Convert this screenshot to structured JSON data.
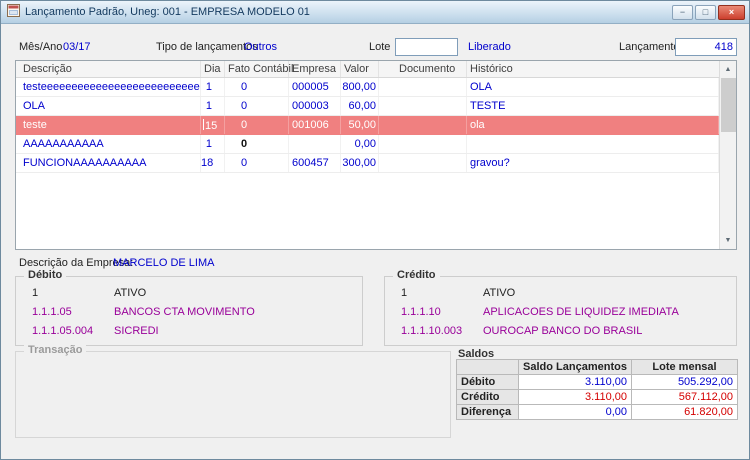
{
  "window": {
    "title": "Lançamento Padrão, Uneg: 001 - EMPRESA MODELO 01"
  },
  "icons": {
    "minimize": "−",
    "maximize": "□",
    "close": "×",
    "scroll_up": "▲",
    "scroll_down": "▼"
  },
  "form": {
    "mes_ano_label": "Mês/Ano",
    "mes_ano_value": "03/17",
    "tipo_label": "Tipo de lançamentos",
    "tipo_value": "Outros",
    "lote_label": "Lote",
    "lote_value": "",
    "status_value": "Liberado",
    "lancamento_label": "Lançamento",
    "lancamento_value": "418"
  },
  "grid": {
    "columns": [
      "Descrição",
      "Dia",
      "Fato Contábil",
      "Empresa",
      "Valor",
      "Documento",
      "Histórico"
    ],
    "rows": [
      {
        "descricao": "testeeeeeeeeeeeeeeeeeeeeeeeeee",
        "dia": "1",
        "fato": "0",
        "empresa": "000005",
        "valor": "800,00",
        "documento": "",
        "historico": "OLA",
        "selected": false
      },
      {
        "descricao": "OLA",
        "dia": "1",
        "fato": "0",
        "empresa": "000003",
        "valor": "60,00",
        "documento": "",
        "historico": "TESTE",
        "selected": false
      },
      {
        "descricao": "teste",
        "dia": "15",
        "fato": "0",
        "empresa": "001006",
        "valor": "50,00",
        "documento": "",
        "historico": "ola",
        "selected": true
      },
      {
        "descricao": "AAAAAAAAAAA",
        "dia": "1",
        "fato": "0",
        "empresa": "",
        "valor": "0,00",
        "documento": "",
        "historico": "",
        "selected": false
      },
      {
        "descricao": "FUNCIONAAAAAAAAAA",
        "dia": "18",
        "fato": "0",
        "empresa": "600457",
        "valor": "300,00",
        "documento": "",
        "historico": "gravou?",
        "selected": false
      }
    ]
  },
  "empresa": {
    "label": "Descrição da Empresa:",
    "value": "MARCELO DE LIMA"
  },
  "debito": {
    "title": "Débito",
    "accounts": [
      {
        "code": "1",
        "name": "ATIVO"
      },
      {
        "code": "1.1.1.05",
        "name": "BANCOS CTA MOVIMENTO"
      },
      {
        "code": "1.1.1.05.004",
        "name": "SICREDI"
      }
    ]
  },
  "credito": {
    "title": "Crédito",
    "accounts": [
      {
        "code": "1",
        "name": "ATIVO"
      },
      {
        "code": "1.1.1.10",
        "name": "APLICACOES DE LIQUIDEZ IMEDIATA"
      },
      {
        "code": "1.1.1.10.003",
        "name": "OUROCAP BANCO DO BRASIL"
      }
    ]
  },
  "transacao": {
    "title": "Transação"
  },
  "saldos": {
    "title": "Saldos",
    "col_saldo": "Saldo Lançamentos",
    "col_lote": "Lote mensal",
    "rows": [
      {
        "label": "Débito",
        "saldo": "3.110,00",
        "lote": "505.292,00"
      },
      {
        "label": "Crédito",
        "saldo": "3.110,00",
        "lote": "567.112,00"
      },
      {
        "label": "Diferença",
        "saldo": "0,00",
        "lote": "61.820,00"
      }
    ]
  },
  "colors": {
    "accent_blue": "#0000cd",
    "negative_red": "#d40000",
    "selected_row_bg": "#f08080",
    "account_purple": "#990099",
    "titlebar_text": "#13395e"
  }
}
